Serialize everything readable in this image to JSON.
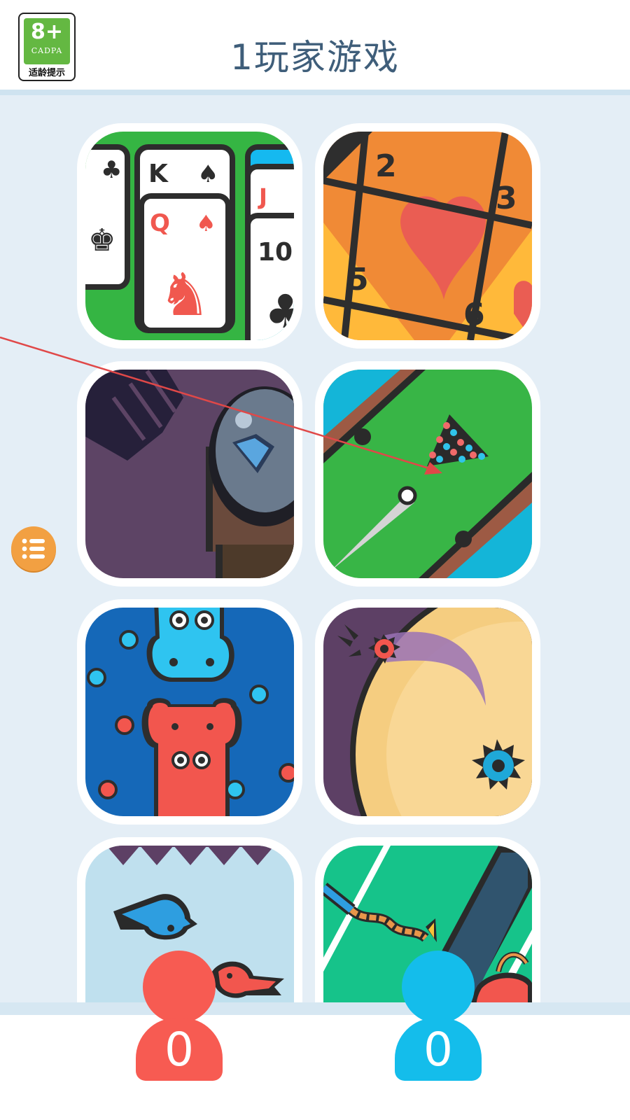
{
  "header": {
    "title": "1玩家游戏",
    "age_badge": {
      "rating": "8+",
      "org": "CADPA",
      "tip": "适龄提示"
    }
  },
  "games": [
    {
      "id": "solitaire",
      "cards": {
        "k": "K",
        "q": "Q",
        "j": "J",
        "ten": "10"
      }
    },
    {
      "id": "number-tiles",
      "numbers": {
        "n2": "2",
        "n3": "3",
        "n5": "5",
        "n6": "6"
      }
    },
    {
      "id": "diamond-heist"
    },
    {
      "id": "pool"
    },
    {
      "id": "hippo"
    },
    {
      "id": "spike-ball"
    },
    {
      "id": "bird-flap"
    },
    {
      "id": "rope-race"
    }
  ],
  "menu": {
    "icon": "list-icon"
  },
  "players": [
    {
      "name": "player-red",
      "score": "0",
      "color": "#f75b52"
    },
    {
      "name": "player-blue",
      "score": "0",
      "color": "#14bdeb"
    }
  ],
  "colors": {
    "header_text": "#3f5e7a",
    "background": "#e4eef6",
    "menu": "#f2a042",
    "annotation_arrow": "#e04848"
  }
}
